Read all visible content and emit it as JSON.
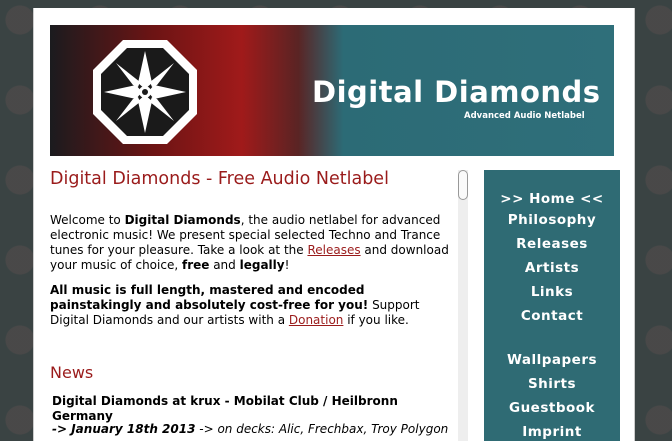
{
  "banner": {
    "title": "Digital Diamonds",
    "subtitle": "Advanced Audio Netlabel"
  },
  "main": {
    "heading": "Digital Diamonds - Free Audio Netlabel",
    "intro": {
      "t1": "Welcome to ",
      "b1": "Digital Diamonds",
      "t2": ", the audio netlabel for advanced electronic music! We present special selected Techno and Trance tunes for your pleasure. Take a look at the ",
      "releases_link": "Releases",
      "t3": " and download your music of choice, ",
      "b2": "free",
      "t4": " and ",
      "b3": "legally",
      "t5": "!"
    },
    "support": {
      "b1": "All music is full length, mastered and encoded painstakingly and absolutely cost-free for you!",
      "t1": " Support Digital Diamonds and our artists with a ",
      "donation_link": "Donation",
      "t2": " if you like."
    },
    "news": {
      "heading": "News",
      "item_title": "Digital Diamonds at krux - Mobilat Club / Heilbronn Germany",
      "item_date": "-> January 18th 2013",
      "item_detail": " -> on decks: Alic, Frechbax, Troy Polygon"
    }
  },
  "nav": {
    "home": ">> Home <<",
    "philosophy": "Philosophy",
    "releases": "Releases",
    "artists": "Artists",
    "links": "Links",
    "contact": "Contact",
    "wallpapers": "Wallpapers",
    "shirts": "Shirts",
    "guestbook": "Guestbook",
    "imprint": "Imprint"
  },
  "colors": {
    "accent_red": "#9a1b1b",
    "nav_teal": "#2f6b74",
    "banner_red": "#a01a1a"
  },
  "icons": [
    "diamond-logo-icon"
  ]
}
